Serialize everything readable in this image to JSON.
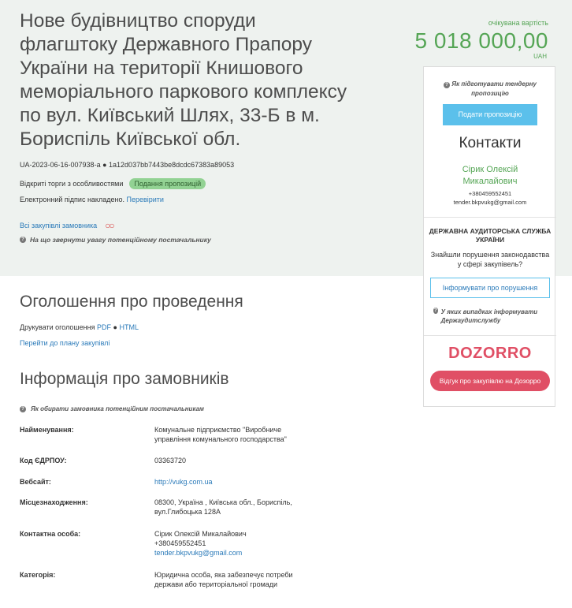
{
  "header": {
    "title": "Нове будівництво споруди флагштоку Державного Прапору України на території Книшового меморіального паркового комплексу по вул. Київський Шлях, 33-Б в м. Бориспіль Київської обл.",
    "tender_id": "UA-2023-06-16-007938-a",
    "tender_hash": "1a12d037bb7443be8dcdc67383a89053",
    "procedure": "Відкриті торги з особливостями",
    "status_badge": "Подання пропозицій",
    "signature_text": "Електронний підпис накладено.",
    "signature_check": "Перевірити",
    "all_procurements": "Всі закупівлі замовника",
    "attention_text": "На що звернути увагу потенційному постачальнику"
  },
  "price": {
    "label": "очікувана вартість",
    "value": "5 018 000,00",
    "currency": "UAH"
  },
  "sidebar": {
    "help_text": "Як підготувати тендерну пропозицію",
    "offer_button": "Подати пропозицію",
    "contacts_title": "Контакти",
    "contact_name": "Сірик Олексій Микалайович",
    "contact_phone": "+380459552451",
    "contact_email": "tender.bkpvukg@gmail.com",
    "audit_title": "ДЕРЖАВНА АУДИТОРСЬКА СЛУЖБА УКРАЇНИ",
    "audit_question": "Знайшли порушення законодавства у сфері закупівель?",
    "inform_button": "Інформувати про порушення",
    "audit_help": "У яких випадках інформувати Держаудитслужбу",
    "dozorro_logo": "DOZORRO",
    "dozorro_button": "Відгук про закупівлю на Дозорро"
  },
  "announcement": {
    "title": "Оголошення про проведення",
    "print_label": "Друкувати оголошення",
    "pdf_link": "PDF",
    "html_link": "HTML",
    "plan_link": "Перейти до плану закупівлі"
  },
  "customer": {
    "title": "Інформація про замовників",
    "help_text": "Як обирати замовника потенційним постачальникам",
    "name_label": "Найменування:",
    "name_value": "Комунальне підприємство \"Виробниче управління комунального господарства\"",
    "edrpou_label": "Код ЄДРПОУ:",
    "edrpou_value": "03363720",
    "website_label": "Вебсайт:",
    "website_value": "http://vukg.com.ua",
    "location_label": "Місцезнаходження:",
    "location_line1": "08300, Україна , Київська обл., Бориспіль,",
    "location_line2": "вул.Глибоцька 128А",
    "contact_label": "Контактна особа:",
    "contact_name": "Сірик Олексій Микалайович",
    "contact_phone": "+380459552451",
    "contact_email": "tender.bkpvukg@gmail.com",
    "category_label": "Категорія:",
    "category_value": "Юридична особа, яка забезпечує потреби держави або територіальної громади"
  },
  "colors": {
    "accent_green": "#55a555",
    "link_blue": "#2a7ab9",
    "button_blue": "#5bc0eb",
    "dozorro_red": "#e04f65",
    "band_bg": "#eef2ef"
  },
  "icons": {
    "help": "question-circle-icon",
    "glasses": "glasses-icon"
  }
}
